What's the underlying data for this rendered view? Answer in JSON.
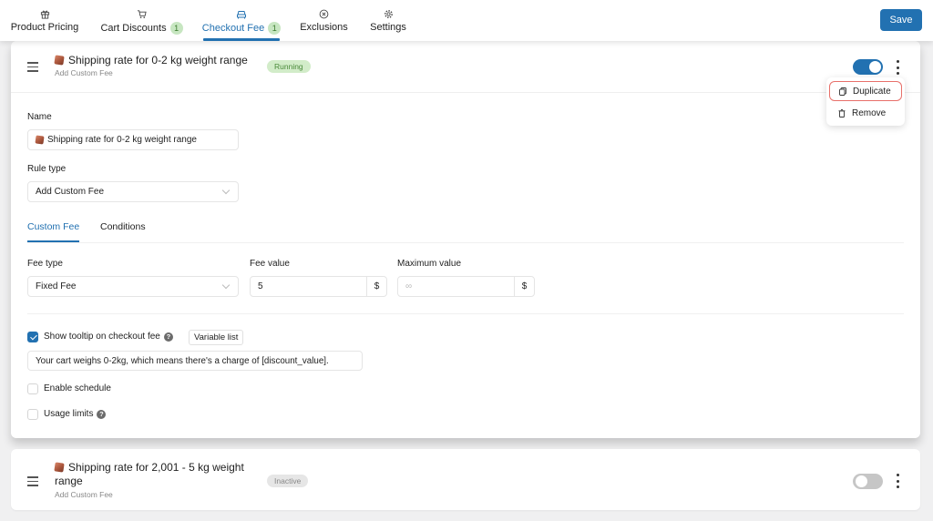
{
  "nav": {
    "tabs": [
      {
        "label": "Product Pricing",
        "icon": "gift-icon",
        "badge": null
      },
      {
        "label": "Cart Discounts",
        "icon": "cart-icon",
        "badge": "1"
      },
      {
        "label": "Checkout Fee",
        "icon": "car-icon",
        "badge": "1",
        "active": true
      },
      {
        "label": "Exclusions",
        "icon": "circle-x-icon",
        "badge": null
      },
      {
        "label": "Settings",
        "icon": "gear-icon",
        "badge": null
      }
    ],
    "save_label": "Save"
  },
  "rules": [
    {
      "title": "Shipping rate for 0-2 kg weight range",
      "subtitle": "Add Custom Fee",
      "status": "Running",
      "enabled": true,
      "expanded": true
    },
    {
      "title": "Shipping rate for 2,001 - 5 kg weight range",
      "subtitle": "Add Custom Fee",
      "status": "Inactive",
      "enabled": false,
      "expanded": false
    }
  ],
  "menu": {
    "duplicate_label": "Duplicate",
    "remove_label": "Remove"
  },
  "form": {
    "name_label": "Name",
    "name_value": "Shipping rate for 0-2 kg weight range",
    "rule_type_label": "Rule type",
    "rule_type_value": "Add Custom Fee",
    "subtabs": [
      "Custom Fee",
      "Conditions"
    ],
    "fee_type_label": "Fee type",
    "fee_type_value": "Fixed Fee",
    "fee_value_label": "Fee value",
    "fee_value": "5",
    "currency_symbol": "$",
    "max_value_label": "Maximum value",
    "max_value_placeholder": "∞",
    "show_tooltip_label": "Show tooltip on checkout fee",
    "show_tooltip_checked": true,
    "variable_list_label": "Variable list",
    "tooltip_text": "Your cart weighs 0-2kg, which means there's a charge of [discount_value].",
    "enable_schedule_label": "Enable schedule",
    "enable_schedule_checked": false,
    "usage_limits_label": "Usage limits",
    "usage_limits_checked": false
  },
  "colors": {
    "accent": "#2271b1",
    "running_bg": "#d2ecc9",
    "highlight_ring": "#e8706a"
  }
}
